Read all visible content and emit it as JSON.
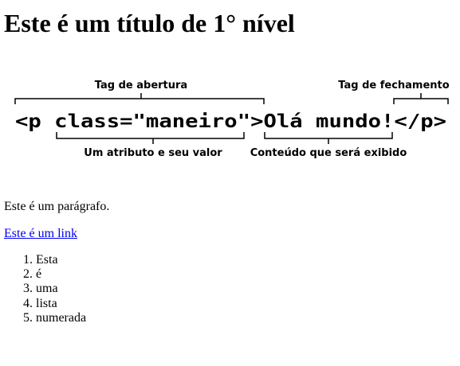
{
  "heading": "Este é um título de 1° nível",
  "diagram": {
    "code": {
      "open_tag": "<p class=\"maneiro\">",
      "content": "Olá mundo!",
      "close_tag": "</p>"
    },
    "labels": {
      "opening_tag": "Tag de abertura",
      "closing_tag": "Tag de fechamento",
      "attribute": "Um atributo e seu valor",
      "content": "Conteúdo que será exibido"
    }
  },
  "paragraph": "Este é um parágrafo.",
  "link_text": "Este é um link",
  "list_items": [
    "Esta",
    "é",
    "uma",
    "lista",
    "numerada"
  ]
}
